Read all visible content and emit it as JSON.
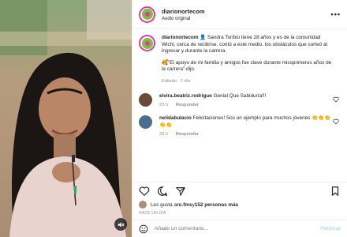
{
  "header": {
    "username": "diarionortecom",
    "audio": "Audio original",
    "more": "•••"
  },
  "caption": {
    "username": "diarionortecom",
    "text1": "👤 Sandra Toribio tiene 28 años y es de la comunidad Wichi, cerca de recibirse. contó a este medio. los obstáculos que sorteó al ingresar y durante la carrera.",
    "text2": "🥰\"El apoyo de mi familia y amigos fue clave durante missprimeros años de la carrera\".dijo.",
    "meta": "Editado · 1 día"
  },
  "comments": [
    {
      "username": "elvira.beatriz.rodrigue",
      "text": "Genial Que Sabiduría!!!",
      "age": "23 h",
      "reply": "Responder",
      "avatar_color": "#6b4a3a"
    },
    {
      "username": "nelidabulacio",
      "text": "Felicitaciones! Sos un ejemplo para muchos jóvenes 👏👏👏👏👏",
      "age": "23 h",
      "reply": "Responder",
      "avatar_color": "#4a6f8a"
    }
  ],
  "likes": {
    "prefix": "Les gusta a ",
    "user": "ro.fms",
    "mid": " y ",
    "count": "152 personas más"
  },
  "timestamp": "HACE UN DÍA",
  "add_comment": {
    "placeholder": "Añade un comentario...",
    "post": "Publicar"
  },
  "colors": {
    "accent_ring": "#e23aa0",
    "logo_green": "#7ac143",
    "muted": "#8e8e8e",
    "post_disabled": "#b2dffc"
  },
  "icons": {
    "header_avatar": "diarionorte-logo",
    "like": "heart-icon",
    "comment": "comment-icon",
    "share": "paper-plane-icon",
    "save": "bookmark-icon",
    "emoji": "smiley-icon",
    "mute": "speaker-muted-icon"
  }
}
